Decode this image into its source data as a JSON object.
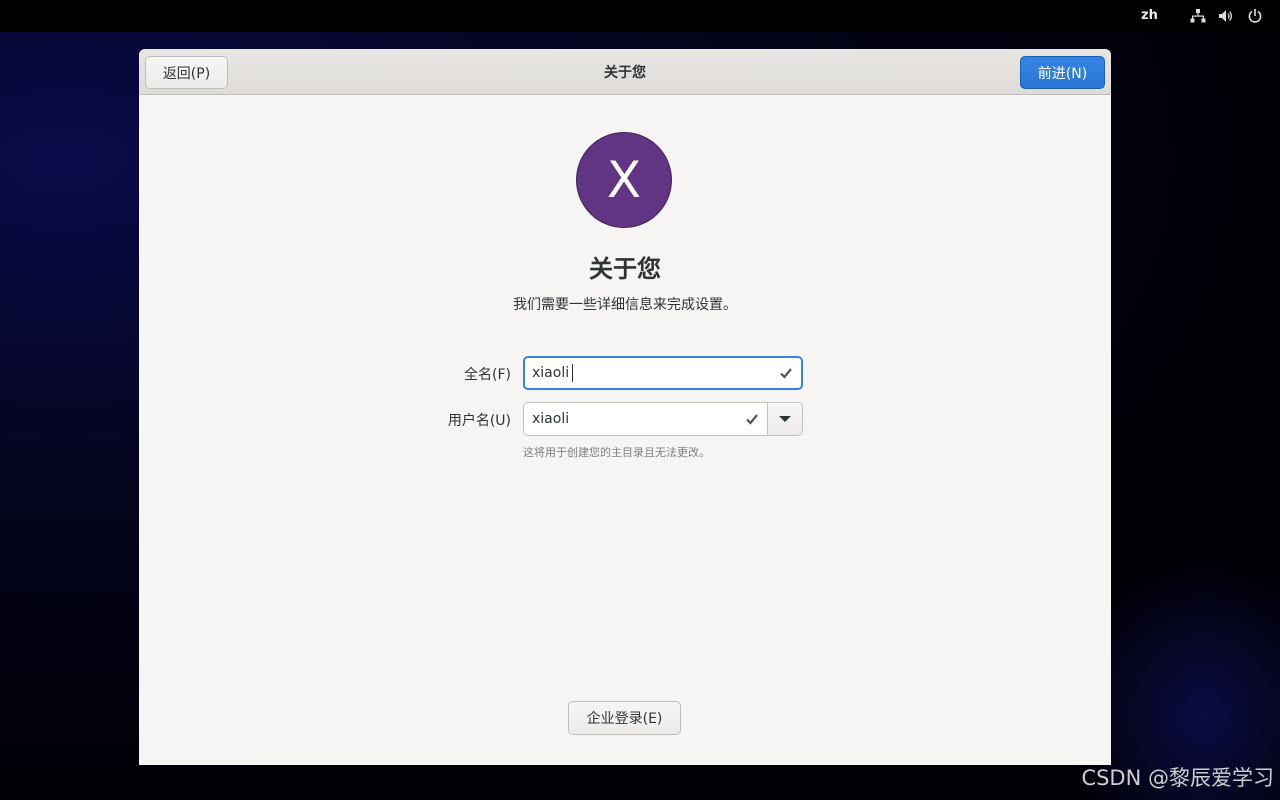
{
  "topbar": {
    "language": "zh",
    "icons": [
      "network-icon",
      "volume-icon",
      "power-icon"
    ]
  },
  "window": {
    "back_label": "返回(P)",
    "title": "关于您",
    "next_label": "前进(N)"
  },
  "main": {
    "avatar_initial": "X",
    "heading": "关于您",
    "subtitle": "我们需要一些详细信息来完成设置。",
    "full_name": {
      "label": "全名(F)",
      "value": "xiaoli"
    },
    "username": {
      "label": "用户名(U)",
      "value": "xiaoli"
    },
    "hint": "这将用于创建您的主目录且无法更改。",
    "enterprise_label": "企业登录(E)"
  },
  "watermark": "CSDN @黎辰爱学习",
  "colors": {
    "accent": "#3584e4",
    "avatar": "#613583"
  }
}
